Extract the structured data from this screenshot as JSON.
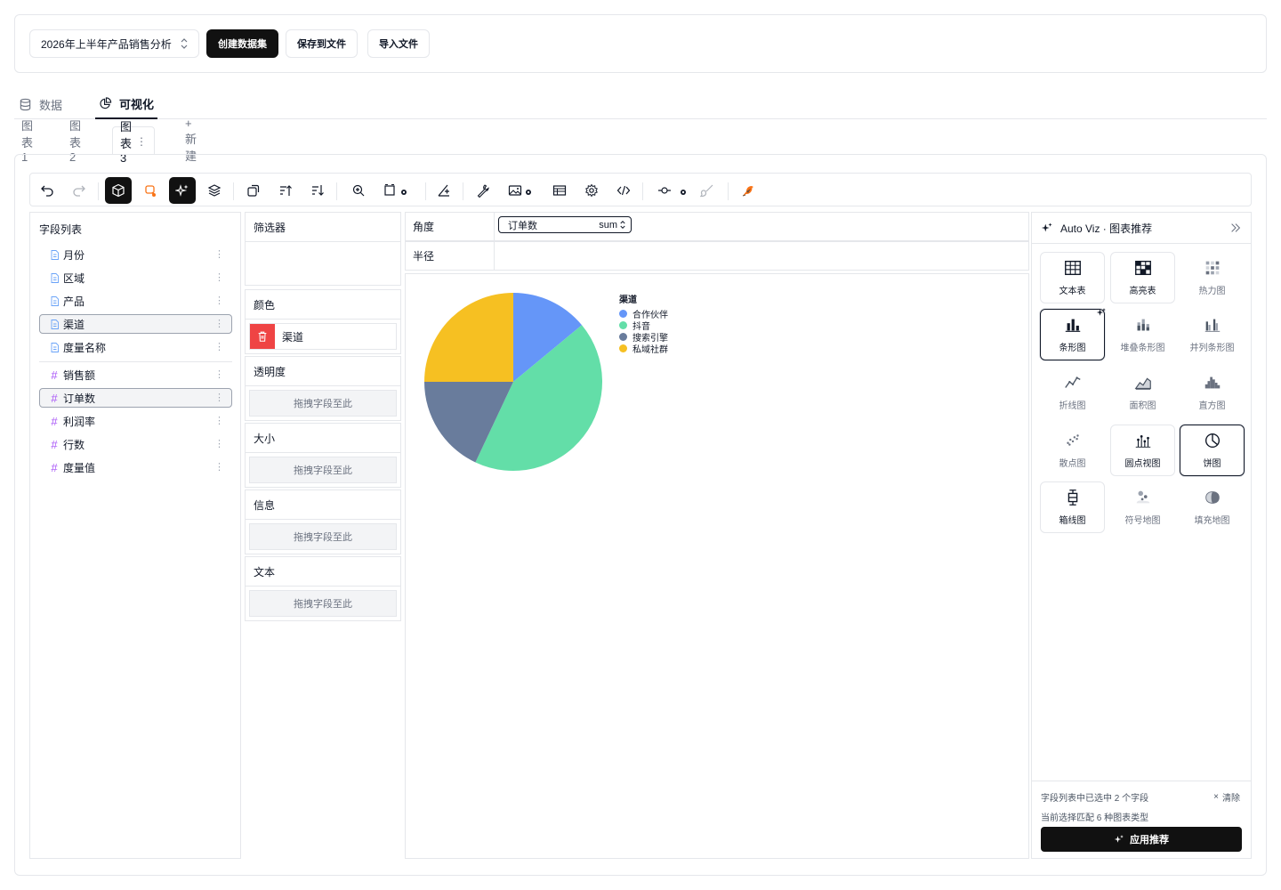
{
  "topbar": {
    "dataset_select": "2026年上半年产品销售分析",
    "create_dataset": "创建数据集",
    "save_to_file": "保存到文件",
    "import_file": "导入文件"
  },
  "main_tabs": [
    {
      "label": "数据",
      "icon": "database-icon",
      "active": false
    },
    {
      "label": "可视化",
      "icon": "pie-chart-icon",
      "active": true
    }
  ],
  "chart_tabs": [
    {
      "label": "图表 1",
      "active": false
    },
    {
      "label": "图表 2",
      "active": false
    },
    {
      "label": "图表 3",
      "active": true
    },
    {
      "label": "+ 新建",
      "active": false
    }
  ],
  "field_list": {
    "title": "字段列表",
    "dimensions": [
      {
        "label": "月份",
        "selected": false
      },
      {
        "label": "区域",
        "selected": false
      },
      {
        "label": "产品",
        "selected": false
      },
      {
        "label": "渠道",
        "selected": true
      },
      {
        "label": "度量名称",
        "selected": false
      }
    ],
    "measures": [
      {
        "label": "销售额",
        "selected": false
      },
      {
        "label": "订单数",
        "selected": true
      },
      {
        "label": "利润率",
        "selected": false
      },
      {
        "label": "行数",
        "selected": false
      },
      {
        "label": "度量值",
        "selected": false
      }
    ]
  },
  "shelves": {
    "filter": "筛选器",
    "color": "颜色",
    "color_field": "渠道",
    "opacity": "透明度",
    "size": "大小",
    "info": "信息",
    "text": "文本",
    "drop_hint": "拖拽字段至此"
  },
  "encoding": {
    "angle_label": "角度",
    "angle_field": "订单数",
    "angle_agg": "sum",
    "radius_label": "半径"
  },
  "chart_data": {
    "type": "pie",
    "legend_title": "渠道",
    "legend_position": "right",
    "slices": [
      {
        "name": "合作伙伴",
        "value": 14,
        "color": "#6596f8"
      },
      {
        "name": "抖音",
        "value": 43,
        "color": "#63dea8"
      },
      {
        "name": "搜索引擎",
        "value": 18,
        "color": "#697c9c"
      },
      {
        "name": "私域社群",
        "value": 25,
        "color": "#f6c022"
      }
    ]
  },
  "autoviz": {
    "title": "Auto Viz · 图表推荐",
    "cells": [
      {
        "label": "文本表",
        "icon": "table-icon",
        "state": "box"
      },
      {
        "label": "高亮表",
        "icon": "highlight-table-icon",
        "state": "box"
      },
      {
        "label": "热力图",
        "icon": "heatmap-icon",
        "state": "faded"
      },
      {
        "label": "条形图",
        "icon": "bar-chart-icon",
        "state": "sel"
      },
      {
        "label": "堆叠条形图",
        "icon": "stacked-bar-icon",
        "state": "faded"
      },
      {
        "label": "并列条形图",
        "icon": "grouped-bar-icon",
        "state": "faded"
      },
      {
        "label": "折线图",
        "icon": "line-chart-icon",
        "state": "faded"
      },
      {
        "label": "面积图",
        "icon": "area-chart-icon",
        "state": "faded"
      },
      {
        "label": "直方图",
        "icon": "histogram-icon",
        "state": "faded"
      },
      {
        "label": "散点图",
        "icon": "scatter-icon",
        "state": "faded"
      },
      {
        "label": "圆点视图",
        "icon": "dot-plot-icon",
        "state": "box"
      },
      {
        "label": "饼图",
        "icon": "pie-icon",
        "state": "sel"
      },
      {
        "label": "箱线图",
        "icon": "boxplot-icon",
        "state": "box"
      },
      {
        "label": "符号地图",
        "icon": "symbol-map-icon",
        "state": "faded"
      },
      {
        "label": "填充地图",
        "icon": "filled-map-icon",
        "state": "faded"
      }
    ],
    "footer_selected": "字段列表中已选中 2 个字段",
    "footer_clear": "清除",
    "footer_match": "当前选择匹配 6 种图表类型",
    "apply_button": "应用推荐"
  },
  "colors": {
    "accent_dark": "#111111",
    "delete_red": "#ef4444",
    "measure_purple": "#a855f7",
    "dimension_blue": "#6aa3f8"
  }
}
